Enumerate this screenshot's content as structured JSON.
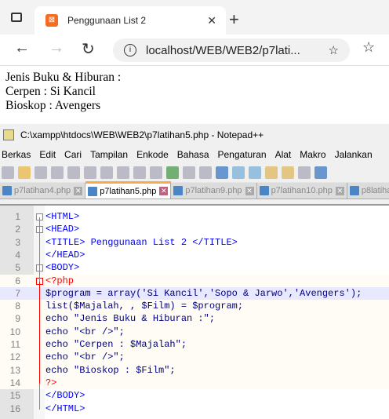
{
  "browser": {
    "tab_title": "Penggunaan List 2",
    "address": "localhost/WEB/WEB2/p7lati...",
    "new_tab": "+"
  },
  "page": {
    "lines": [
      "Jenis Buku & Hiburan :",
      "Cerpen : Si Kancil",
      "Bioskop : Avengers"
    ]
  },
  "notepad": {
    "title": "C:\\xampp\\htdocs\\WEB\\WEB2\\p7latihan5.php - Notepad++",
    "menu": [
      "Berkas",
      "Edit",
      "Cari",
      "Tampilan",
      "Enkode",
      "Bahasa",
      "Pengaturan",
      "Alat",
      "Makro",
      "Jalankan"
    ],
    "tabs": [
      "p7latihan4.php",
      "p7latihan5.php",
      "p7latihan9.php",
      "p7latihan10.php",
      "p8latiha"
    ],
    "code": [
      "<HTML>",
      "<HEAD>",
      "<TITLE> Penggunaan List 2 </TITLE>",
      "</HEAD>",
      "<BODY>",
      "<?php",
      "$program = array('Si Kancil','Sopo & Jarwo','Avengers');",
      "list($Majalah, , $Film) = $program;",
      "echo \"Jenis Buku & Hiburan :\";",
      "echo \"<br />\";",
      "echo \"Cerpen : $Majalah\";",
      "echo \"<br />\";",
      "echo \"Bioskop : $Film\";",
      "?>",
      "</BODY>",
      "</HTML>"
    ]
  }
}
